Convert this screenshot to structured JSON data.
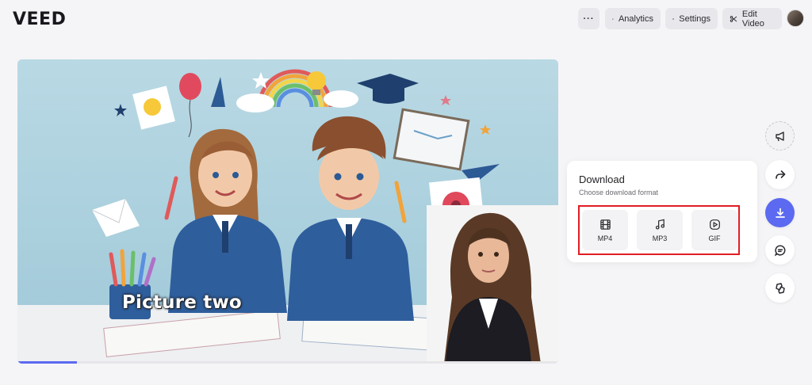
{
  "brand": {
    "logo_text": "VEED"
  },
  "header": {
    "more_label": "···",
    "analytics_label": "Analytics",
    "settings_label": "Settings",
    "edit_video_label": "Edit Video"
  },
  "video": {
    "caption": "Picture two",
    "progress_fraction": 0.11
  },
  "download": {
    "title": "Download",
    "subtitle": "Choose download format",
    "formats": [
      {
        "label": "MP4",
        "icon": "film-icon"
      },
      {
        "label": "MP3",
        "icon": "music-note-icon"
      },
      {
        "label": "GIF",
        "icon": "play-circle-icon"
      }
    ]
  },
  "sidebar": {
    "actions": [
      "megaphone-icon",
      "share-arrow-icon",
      "download-icon",
      "comment-icon",
      "reaction-icon"
    ]
  },
  "colors": {
    "accent": "#5b6af0",
    "highlight_border": "#e11d24",
    "page_bg": "#f5f5f7"
  }
}
